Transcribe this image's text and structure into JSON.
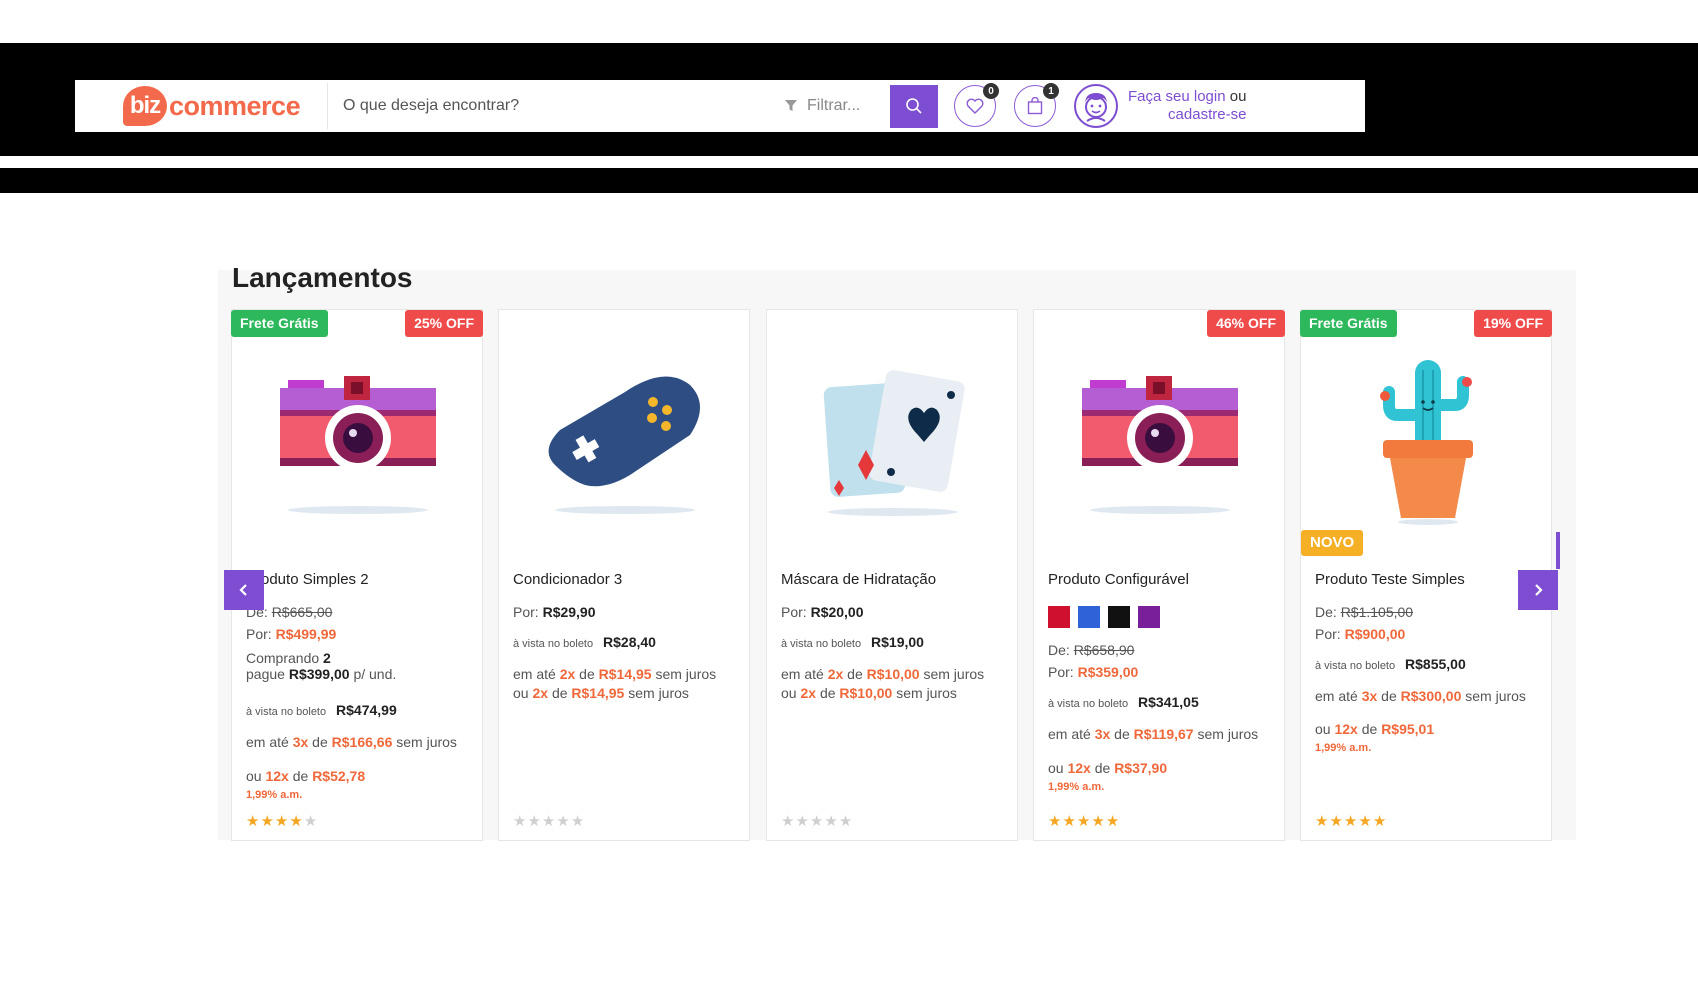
{
  "header": {
    "logo_badge": "biz",
    "logo_text": "commerce",
    "search_placeholder": "O que deseja encontrar?",
    "filter_label": "Filtrar...",
    "wishlist_count": "0",
    "cart_count": "1",
    "login_link": "Faça seu login",
    "login_or": "ou",
    "signup_link": "cadastre-se"
  },
  "section": {
    "title": "Lançamentos"
  },
  "colors": {
    "brand": "#7d4ed1",
    "accent": "#f0683a",
    "free_shipping": "#2db85c",
    "discount": "#ef4b4b",
    "new": "#f6b026"
  },
  "products": [
    {
      "free_shipping": "Frete Grátis",
      "discount": "25% OFF",
      "name": "Produto Simples 2",
      "de_label": "De:",
      "de_price": "R$665,00",
      "por_label": "Por:",
      "por_price": "R$499,99",
      "bulk_label": "Comprando",
      "bulk_qty": "2",
      "bulk_pay": "pague",
      "bulk_price": "R$399,00",
      "bulk_unit": "p/ und.",
      "boleto_label": "à vista no boleto",
      "boleto_price": "R$474,99",
      "inst_prefix": "em até",
      "inst_times": "3x",
      "inst_de": "de",
      "inst_value": "R$166,66",
      "inst_suffix": "sem juros",
      "inst2_prefix": "ou",
      "inst2_times": "12x",
      "inst2_de": "de",
      "inst2_value": "R$52,78",
      "interest": "1,99% a.m.",
      "rating": 4,
      "icon": "camera-icon"
    },
    {
      "name": "Condicionador 3",
      "por_label": "Por:",
      "por_price": "R$29,90",
      "boleto_label": "à vista no boleto",
      "boleto_price": "R$28,40",
      "inst_prefix": "em até",
      "inst_times": "2x",
      "inst_de": "de",
      "inst_value": "R$14,95",
      "inst_suffix": "sem juros",
      "inst2_prefix": "ou",
      "inst2_times": "2x",
      "inst2_de": "de",
      "inst2_value": "R$14,95",
      "inst2_suffix": "sem juros",
      "rating": 0,
      "icon": "gamepad-icon"
    },
    {
      "name": "Máscara de Hidratação",
      "por_label": "Por:",
      "por_price": "R$20,00",
      "boleto_label": "à vista no boleto",
      "boleto_price": "R$19,00",
      "inst_prefix": "em até",
      "inst_times": "2x",
      "inst_de": "de",
      "inst_value": "R$10,00",
      "inst_suffix": "sem juros",
      "inst2_prefix": "ou",
      "inst2_times": "2x",
      "inst2_de": "de",
      "inst2_value": "R$10,00",
      "inst2_suffix": "sem juros",
      "rating": 0,
      "icon": "playing-cards-icon"
    },
    {
      "discount": "46% OFF",
      "name": "Produto Configurável",
      "swatches": [
        "#d0102f",
        "#2f62d6",
        "#111111",
        "#7a1f9a"
      ],
      "de_label": "De:",
      "de_price": "R$658,90",
      "por_label": "Por:",
      "por_price": "R$359,00",
      "boleto_label": "à vista no boleto",
      "boleto_price": "R$341,05",
      "inst_prefix": "em até",
      "inst_times": "3x",
      "inst_de": "de",
      "inst_value": "R$119,67",
      "inst_suffix": "sem juros",
      "inst2_prefix": "ou",
      "inst2_times": "12x",
      "inst2_de": "de",
      "inst2_value": "R$37,90",
      "interest": "1,99% a.m.",
      "rating": 5,
      "icon": "camera-icon"
    },
    {
      "free_shipping": "Frete Grátis",
      "discount": "19% OFF",
      "new_badge": "NOVO",
      "name": "Produto Teste Simples",
      "de_label": "De:",
      "de_price": "R$1.105,00",
      "por_label": "Por:",
      "por_price": "R$900,00",
      "boleto_label": "à vista no boleto",
      "boleto_price": "R$855,00",
      "inst_prefix": "em até",
      "inst_times": "3x",
      "inst_de": "de",
      "inst_value": "R$300,00",
      "inst_suffix": "sem juros",
      "inst2_prefix": "ou",
      "inst2_times": "12x",
      "inst2_de": "de",
      "inst2_value": "R$95,01",
      "interest": "1,99% a.m.",
      "rating": 5,
      "icon": "cactus-icon"
    }
  ]
}
